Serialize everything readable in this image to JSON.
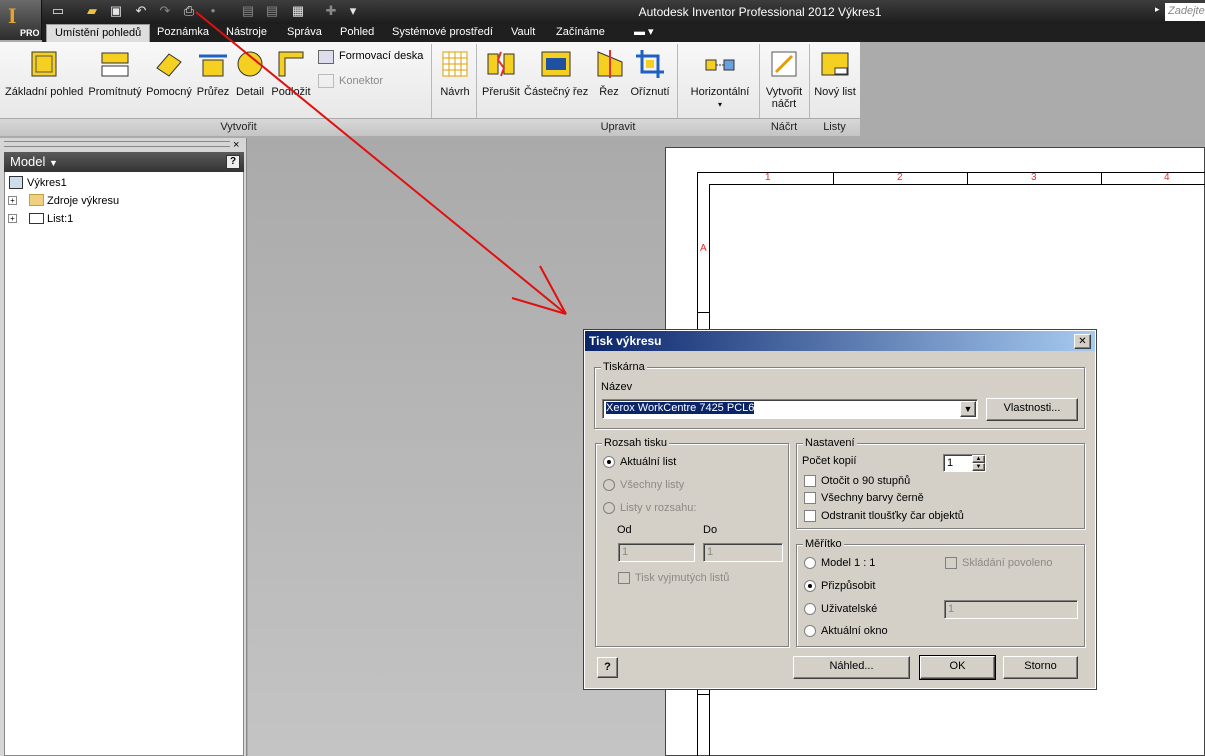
{
  "app": {
    "pro_label": "PRO",
    "title": "Autodesk Inventor Professional 2012   Výkres1",
    "search_placeholder": "Zadejte"
  },
  "tabs": [
    "Umístění pohledů",
    "Poznámka",
    "Nástroje",
    "Správa",
    "Pohled",
    "Systémové prostředí",
    "Vault",
    "Začínáme"
  ],
  "ribbon": {
    "create": [
      "Základní pohled",
      "Promítnutý",
      "Pomocný",
      "Průřez",
      "Detail",
      "Podložit"
    ],
    "formovaci": "Formovací deska",
    "konektor": "Konektor",
    "navrh": "Návrh",
    "modify": [
      "Přerušit",
      "Částečný řez",
      "Řez",
      "Oříznutí"
    ],
    "horizontalni": "Horizontální",
    "sketch": [
      "Vytvořit",
      "náčrt"
    ],
    "sheet": "Nový list",
    "panels": [
      "Vytvořit",
      "Upravit",
      "Náčrt",
      "Listy"
    ]
  },
  "browser": {
    "header": "Model",
    "help": "?",
    "items": [
      "Výkres1",
      "Zdroje výkresu",
      "List:1"
    ],
    "close": "×"
  },
  "sheet": {
    "cols": [
      "1",
      "2",
      "3",
      "4"
    ],
    "row": "A"
  },
  "dialog": {
    "title": "Tisk výkresu",
    "close": "✕",
    "printer_group": "Tiskárna",
    "name_label": "Název",
    "printer_value": "Xerox WorkCentre 7425 PCL6",
    "properties": "Vlastnosti...",
    "range_group": "Rozsah tisku",
    "range_current": "Aktuální list",
    "range_all": "Všechny listy",
    "range_in": "Listy v rozsahu:",
    "from": "Od",
    "to": "Do",
    "from_val": "1",
    "to_val": "1",
    "excluded": "Tisk vyjmutých listů",
    "settings_group": "Nastavení",
    "copies_label": "Počet kopií",
    "copies_val": "1",
    "rotate": "Otočit o 90 stupňů",
    "black": "Všechny barvy černě",
    "lineweights": "Odstranit tloušťky čar objektů",
    "scale_group": "Měřítko",
    "model11": "Model 1 : 1",
    "tiling": "Skládání povoleno",
    "fit": "Přizpůsobit",
    "custom": "Uživatelské",
    "custom_val": "1",
    "window": "Aktuální okno",
    "help": "?",
    "preview": "Náhled...",
    "ok": "OK",
    "cancel": "Storno"
  },
  "colors": {
    "arrow": "#e01010",
    "title_grad_start": "#0a246a",
    "sheet_text": "#e03030"
  }
}
